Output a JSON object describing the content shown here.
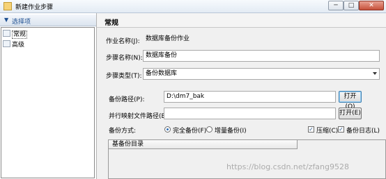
{
  "window": {
    "title": "新建作业步骤",
    "minimize": "─",
    "maximize": "□",
    "close": "✕"
  },
  "sidebar": {
    "header": "选择项",
    "items": [
      {
        "label": "常规",
        "selected": true
      },
      {
        "label": "高级",
        "selected": false
      }
    ]
  },
  "main": {
    "section_title": "常规",
    "job_name_label": "作业名称(J):",
    "job_name_value": "数据库备份作业",
    "step_name_label": "步骤名称(N):",
    "step_name_value": "数据库备份",
    "step_type_label": "步骤类型(T):",
    "step_type_value": "备份数据库",
    "backup_path_label": "备份路径(P):",
    "backup_path_value": "D:\\dm7_bak",
    "open_button_1": "打开(O)",
    "mapping_path_label": "并行映射文件路径(B):",
    "mapping_path_value": "",
    "open_button_2": "打开(E)",
    "backup_mode_label": "备份方式:",
    "full_backup": "完全备份(F)",
    "incremental_backup": "增量备份(I)",
    "compress": "压缩(C)",
    "backup_log": "备份日志(L)",
    "base_backup_dir_header": "基备份目录"
  },
  "watermark": "https://blog.csdn.net/zfang9528"
}
